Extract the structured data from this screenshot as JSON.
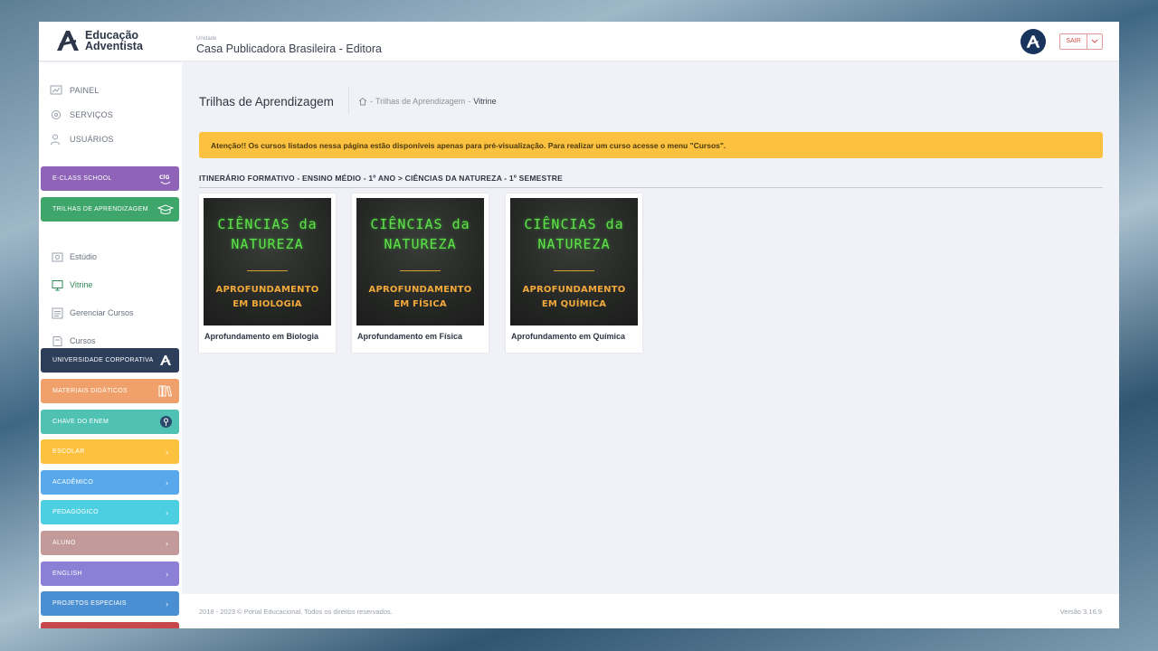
{
  "header": {
    "logo_line1": "Educação",
    "logo_line2": "Adventista",
    "unit_label": "Unidade",
    "unit_name": "Casa Publicadora Brasileira - Editora",
    "logout_label": "SAIR"
  },
  "sidebar": {
    "top_items": [
      {
        "label": "PAINEL",
        "icon": "chart-icon"
      },
      {
        "label": "SERVIÇOS",
        "icon": "gear-icon"
      },
      {
        "label": "USUÁRIOS",
        "icon": "users-icon"
      }
    ],
    "modules": [
      {
        "label": "E-CLASS SCHOOL",
        "color": "#8e63b8",
        "icon": "eclass-icon"
      },
      {
        "label": "TRILHAS DE APRENDIZAGEM",
        "color": "#3ea56b",
        "icon": "graduation-cap-icon"
      },
      {
        "label": "UNIVERSIDADE CORPORATIVA",
        "color": "#2c3e5a",
        "icon": "adventist-logo-icon"
      },
      {
        "label": "MATERIAIS DIDÁTICOS",
        "color": "#f0a06a",
        "icon": "books-icon"
      },
      {
        "label": "CHAVE DO ENEM",
        "color": "#4fc2b4",
        "icon": "enem-icon"
      },
      {
        "label": "ESCOLAR",
        "color": "#fcc13e",
        "icon": "chevron-right-icon"
      },
      {
        "label": "ACADÊMICO",
        "color": "#58a9ec",
        "icon": "chevron-right-icon"
      },
      {
        "label": "PEDAGÓGICO",
        "color": "#4ccfe0",
        "icon": "chevron-right-icon"
      },
      {
        "label": "ALUNO",
        "color": "#c29a9a",
        "icon": "chevron-right-icon"
      },
      {
        "label": "ENGLISH",
        "color": "#8b7fd6",
        "icon": "chevron-right-icon"
      },
      {
        "label": "PROJETOS ESPECIAIS",
        "color": "#4a8fd1",
        "icon": "chevron-right-icon"
      },
      {
        "label": "",
        "color": "#c8474a",
        "icon": ""
      }
    ],
    "trilhas_sub": [
      {
        "label": "Estúdio",
        "icon": "studio-icon"
      },
      {
        "label": "Vitrine",
        "icon": "monitor-icon"
      },
      {
        "label": "Gerenciar Cursos",
        "icon": "manage-icon"
      },
      {
        "label": "Cursos",
        "icon": "courses-icon"
      }
    ]
  },
  "main": {
    "title": "Trilhas de Aprendizagem",
    "breadcrumb": [
      "Trilhas de Aprendizagem",
      "Vitrine"
    ],
    "alert": "Atenção!! Os cursos listados nessa página estão disponíveis apenas para pré-visualização. Para realizar um curso acesse o menu \"Cursos\".",
    "section_title": "ITINERÁRIO FORMATIVO - ENSINO MÉDIO - 1º ANO > CIÊNCIAS DA NATUREZA - 1º SEMESTRE",
    "courses": [
      {
        "name": "Aprofundamento em Biologia",
        "thumb_line1": "CIÊNCIAS da",
        "thumb_line2": "NATUREZA",
        "thumb_sub1": "APROFUNDAMENTO",
        "thumb_sub2": "EM BIOLOGIA"
      },
      {
        "name": "Aprofundamento em Física",
        "thumb_line1": "CIÊNCIAS da",
        "thumb_line2": "NATUREZA",
        "thumb_sub1": "APROFUNDAMENTO",
        "thumb_sub2": "EM FÍSICA"
      },
      {
        "name": "Aprofundamento em Química",
        "thumb_line1": "CIÊNCIAS da",
        "thumb_line2": "NATUREZA",
        "thumb_sub1": "APROFUNDAMENTO",
        "thumb_sub2": "EM QUÍMICA"
      }
    ]
  },
  "footer": {
    "copyright": "2018 - 2023 © Portal Educacional. Todos os direitos reservados.",
    "version": "Versão 3.16.9"
  }
}
